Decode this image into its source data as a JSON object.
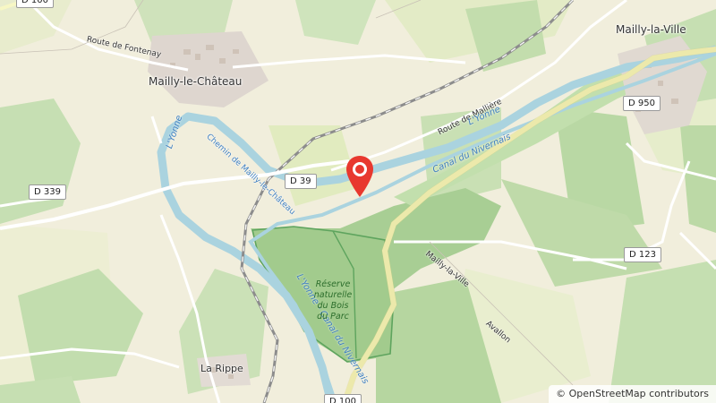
{
  "map": {
    "places": {
      "mailly_chateau": "Mailly-le-Château",
      "mailly_ville": "Mailly-la-Ville",
      "la_rippe": "La Rippe"
    },
    "roads": {
      "d339": "D 339",
      "d39": "D 39",
      "d950": "D 950",
      "d123": "D 123",
      "d100": "D 100",
      "route_fontenay": "Route de Fontenay",
      "route_malliere": "Route de Mallière",
      "road_mailly_ville": "Mailly-la-Ville",
      "road_avallon": "Avallon",
      "chemin": "Chemin de Mailly-le-Château",
      "top_road": "D 100"
    },
    "waterways": {
      "yonne_west": "L'Yonne",
      "yonne_east": "L'Yonne",
      "canal_east": "Canal du Nivernais",
      "yonne_canal_south": "L'Yonne - Canal du Nivernais"
    },
    "reserve": {
      "line1": "Réserve",
      "line2": "naturelle",
      "line3": "du Bois",
      "line4": "du Parc"
    },
    "attribution": "© OpenStreetMap contributors",
    "colors": {
      "water": "#aad3df",
      "forest": "#add19e",
      "farmland": "#eef0d5",
      "reserve_border": "#5ea45e",
      "marker": "#e8382f"
    }
  }
}
